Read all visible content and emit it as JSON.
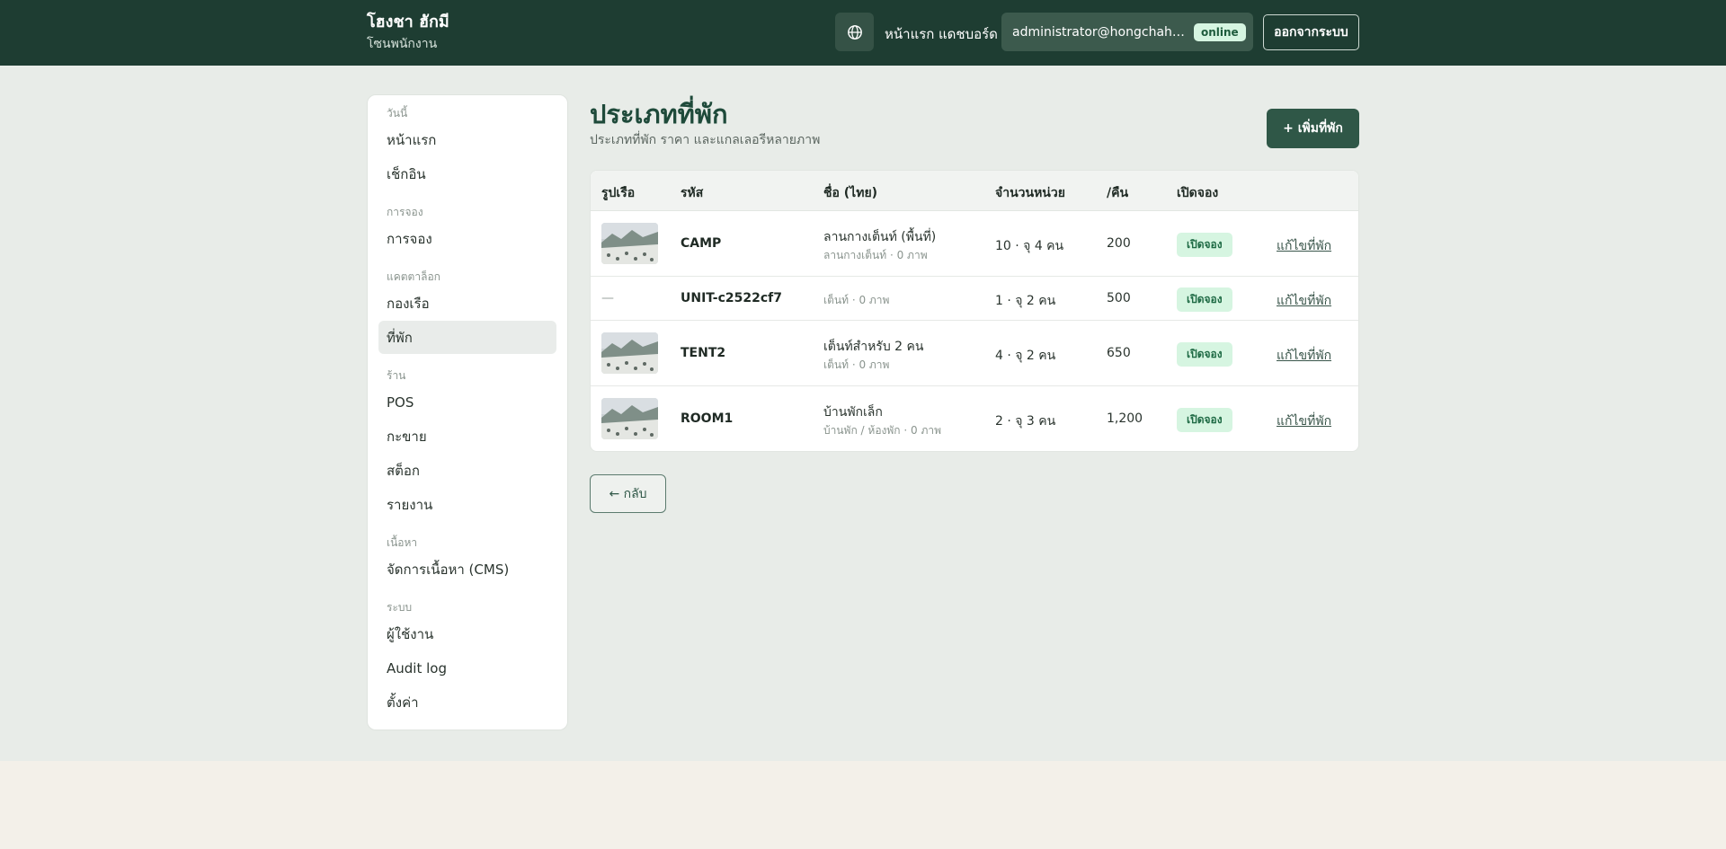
{
  "header": {
    "title": "โฮงชา ฮักมี",
    "subtitle": "โซนพนักงาน",
    "nav": [
      "หน้าแรก",
      "แดชบอร์ด"
    ],
    "user_email": "administrator@hongchahug...",
    "status": "online",
    "logout_label": "ออกจากระบบ"
  },
  "sidebar": {
    "groups": [
      {
        "label": "วันนี้",
        "items": [
          "หน้าแรก",
          "เช็กอิน"
        ]
      },
      {
        "label": "การจอง",
        "items": [
          "การจอง"
        ]
      },
      {
        "label": "แคตตาล็อก",
        "items": [
          "กองเรือ",
          "ที่พัก"
        ]
      },
      {
        "label": "ร้าน",
        "items": [
          "POS",
          "กะขาย",
          "สต็อก",
          "รายงาน"
        ]
      },
      {
        "label": "เนื้อหา",
        "items": [
          "จัดการเนื้อหา (CMS)"
        ]
      },
      {
        "label": "ระบบ",
        "items": [
          "ผู้ใช้งาน",
          "Audit log",
          "ตั้งค่า"
        ]
      }
    ],
    "active_item": "ที่พัก"
  },
  "page": {
    "title": "ประเภทที่พัก",
    "subtitle": "ประเภทที่พัก ราคา และแกลเลอรีหลายภาพ",
    "add_label": "+ เพิ่มที่พัก",
    "back_label": "← กลับ"
  },
  "table": {
    "headers": [
      "รูปเรือ",
      "รหัส",
      "ชื่อ (ไทย)",
      "จำนวนหน่วย",
      "/คืน",
      "เปิดจอง"
    ],
    "rows": [
      {
        "has_image": true,
        "code": "CAMP",
        "name": "ลานกางเต็นท์ (พื้นที่)",
        "sub": "ลานกางเต็นท์ · 0 ภาพ",
        "units": "10 · จุ 4 คน",
        "price": "200",
        "status": "เปิดจอง",
        "action": "แก้ไขที่พัก"
      },
      {
        "has_image": false,
        "placeholder": "—",
        "code": "UNIT-c2522cf7",
        "name": "",
        "sub": "เต็นท์ · 0 ภาพ",
        "units": "1 · จุ 2 คน",
        "price": "500",
        "status": "เปิดจอง",
        "action": "แก้ไขที่พัก"
      },
      {
        "has_image": true,
        "code": "TENT2",
        "name": "เต็นท์สำหรับ 2 คน",
        "sub": "เต็นท์ · 0 ภาพ",
        "units": "4 · จุ 2 คน",
        "price": "650",
        "status": "เปิดจอง",
        "action": "แก้ไขที่พัก"
      },
      {
        "has_image": true,
        "code": "ROOM1",
        "name": "บ้านพักเล็ก",
        "sub": "บ้านพัก / ห้องพัก · 0 ภาพ",
        "units": "2 · จุ 3 คน",
        "price": "1,200",
        "status": "เปิดจอง",
        "action": "แก้ไขที่พัก"
      }
    ]
  },
  "colors": {
    "header_bg": "#1e3d32",
    "accent": "#2f5747",
    "badge_bg": "#d6f5e1"
  }
}
